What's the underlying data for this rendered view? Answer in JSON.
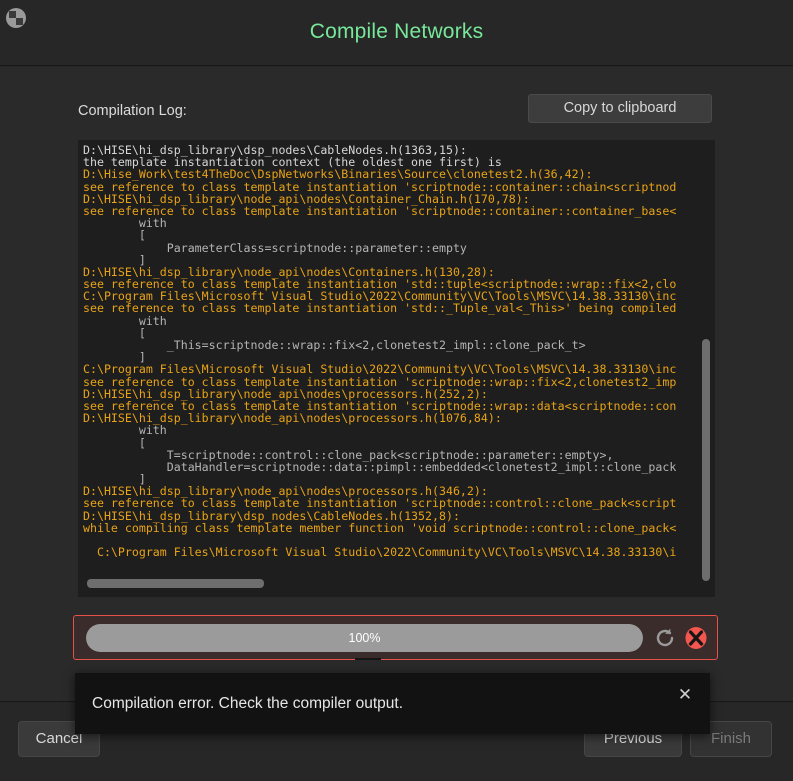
{
  "window": {
    "title": "Compile Networks",
    "app_icon": "app-logo-icon"
  },
  "main": {
    "log_label": "Compilation Log:",
    "copy_button": "Copy to clipboard"
  },
  "log": {
    "lines": [
      {
        "text": "D:\\HISE\\hi_dsp_library\\dsp_nodes\\CableNodes.h(1363,15):",
        "color": "white"
      },
      {
        "text": "the template instantiation context (the oldest one first) is",
        "color": "white"
      },
      {
        "text": "D:\\Hise_Work\\test4TheDoc\\DspNetworks\\Binaries\\Source\\clonetest2.h(36,42):",
        "color": "orange"
      },
      {
        "text": "see reference to class template instantiation 'scriptnode::container::chain<scriptnod",
        "color": "orange"
      },
      {
        "text": "D:\\HISE\\hi_dsp_library\\node_api\\nodes\\Container_Chain.h(170,78):",
        "color": "orange"
      },
      {
        "text": "see reference to class template instantiation 'scriptnode::container::container_base<",
        "color": "orange"
      },
      {
        "text": "        with",
        "color": "grey"
      },
      {
        "text": "        [",
        "color": "grey"
      },
      {
        "text": "            ParameterClass=scriptnode::parameter::empty",
        "color": "grey"
      },
      {
        "text": "        ]",
        "color": "grey"
      },
      {
        "text": "D:\\HISE\\hi_dsp_library\\node_api\\nodes\\Containers.h(130,28):",
        "color": "orange"
      },
      {
        "text": "see reference to class template instantiation 'std::tuple<scriptnode::wrap::fix<2,clo",
        "color": "orange"
      },
      {
        "text": "C:\\Program Files\\Microsoft Visual Studio\\2022\\Community\\VC\\Tools\\MSVC\\14.38.33130\\inc",
        "color": "orange"
      },
      {
        "text": "see reference to class template instantiation 'std::_Tuple_val<_This>' being compiled",
        "color": "orange"
      },
      {
        "text": "        with",
        "color": "grey"
      },
      {
        "text": "        [",
        "color": "grey"
      },
      {
        "text": "            _This=scriptnode::wrap::fix<2,clonetest2_impl::clone_pack_t>",
        "color": "grey"
      },
      {
        "text": "        ]",
        "color": "grey"
      },
      {
        "text": "C:\\Program Files\\Microsoft Visual Studio\\2022\\Community\\VC\\Tools\\MSVC\\14.38.33130\\inc",
        "color": "orange"
      },
      {
        "text": "see reference to class template instantiation 'scriptnode::wrap::fix<2,clonetest2_imp",
        "color": "orange"
      },
      {
        "text": "D:\\HISE\\hi_dsp_library\\node_api\\nodes\\processors.h(252,2):",
        "color": "orange"
      },
      {
        "text": "see reference to class template instantiation 'scriptnode::wrap::data<scriptnode::con",
        "color": "orange"
      },
      {
        "text": "D:\\HISE\\hi_dsp_library\\node_api\\nodes\\processors.h(1076,84):",
        "color": "orange"
      },
      {
        "text": "        with",
        "color": "grey"
      },
      {
        "text": "        [",
        "color": "grey"
      },
      {
        "text": "            T=scriptnode::control::clone_pack<scriptnode::parameter::empty>,",
        "color": "grey"
      },
      {
        "text": "            DataHandler=scriptnode::data::pimpl::embedded<clonetest2_impl::clone_pack",
        "color": "grey"
      },
      {
        "text": "        ]",
        "color": "grey"
      },
      {
        "text": "D:\\HISE\\hi_dsp_library\\node_api\\nodes\\processors.h(346,2):",
        "color": "orange"
      },
      {
        "text": "see reference to class template instantiation 'scriptnode::control::clone_pack<script",
        "color": "orange"
      },
      {
        "text": "D:\\HISE\\hi_dsp_library\\dsp_nodes\\CableNodes.h(1352,8):",
        "color": "orange"
      },
      {
        "text": "while compiling class template member function 'void scriptnode::control::clone_pack<",
        "color": "orange"
      },
      {
        "text": "",
        "color": "grey"
      },
      {
        "text": "  C:\\Program Files\\Microsoft Visual Studio\\2022\\Community\\VC\\Tools\\MSVC\\14.38.33130\\i",
        "color": "orange"
      }
    ],
    "colors": {
      "path": "#e8a317",
      "context": "#d6d6d6",
      "detail": "#b4b4b4",
      "background": "#1e1e1e"
    }
  },
  "progress": {
    "percent_label": "100%",
    "percent_value": 100,
    "border_color": "#e8504a",
    "refresh_icon": "refresh-icon",
    "cancel_icon": "cancel-icon"
  },
  "toast": {
    "message": "Compilation error. Check the compiler output.",
    "close_label": "✕"
  },
  "footer": {
    "cancel": "Cancel",
    "previous": "Previous",
    "finish": "Finish"
  }
}
